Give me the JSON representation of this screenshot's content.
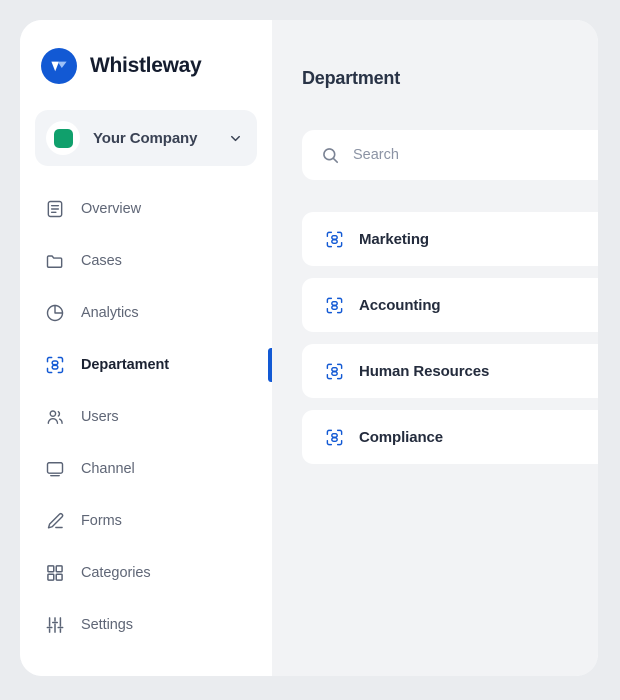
{
  "brand": {
    "name": "Whistleway",
    "logo_icon": "whistleway-logo-icon",
    "logo_color": "#1259d4"
  },
  "company_switcher": {
    "name": "Your Company",
    "avatar_icon": "company-avatar-icon",
    "avatar_color": "#10a06c",
    "chevron_icon": "chevron-down-icon"
  },
  "sidebar": {
    "active_item": "Departament",
    "active_indicator_color": "#1259d4",
    "items": [
      {
        "label": "Overview",
        "icon": "overview-icon",
        "active": false
      },
      {
        "label": "Cases",
        "icon": "folder-icon",
        "active": false
      },
      {
        "label": "Analytics",
        "icon": "pie-chart-icon",
        "active": false
      },
      {
        "label": "Departament",
        "icon": "department-icon",
        "active": true
      },
      {
        "label": "Users",
        "icon": "users-icon",
        "active": false
      },
      {
        "label": "Channel",
        "icon": "monitor-icon",
        "active": false
      },
      {
        "label": "Forms",
        "icon": "pencil-icon",
        "active": false
      },
      {
        "label": "Categories",
        "icon": "grid-icon",
        "active": false
      },
      {
        "label": "Settings",
        "icon": "sliders-icon",
        "active": false
      }
    ]
  },
  "panel": {
    "title": "Department",
    "search": {
      "placeholder": "Search",
      "value": "",
      "icon": "search-icon"
    },
    "departments": [
      {
        "label": "Marketing",
        "icon": "department-icon"
      },
      {
        "label": "Accounting",
        "icon": "department-icon"
      },
      {
        "label": "Human Resources",
        "icon": "department-icon"
      },
      {
        "label": "Compliance",
        "icon": "department-icon"
      }
    ]
  },
  "colors": {
    "page_background": "#eaecef",
    "card_background": "#ffffff",
    "panel_background": "#f2f3f5",
    "accent": "#1259d4",
    "brand_green": "#10a06c",
    "text_primary": "#1b2232",
    "text_muted": "#5f6676"
  }
}
